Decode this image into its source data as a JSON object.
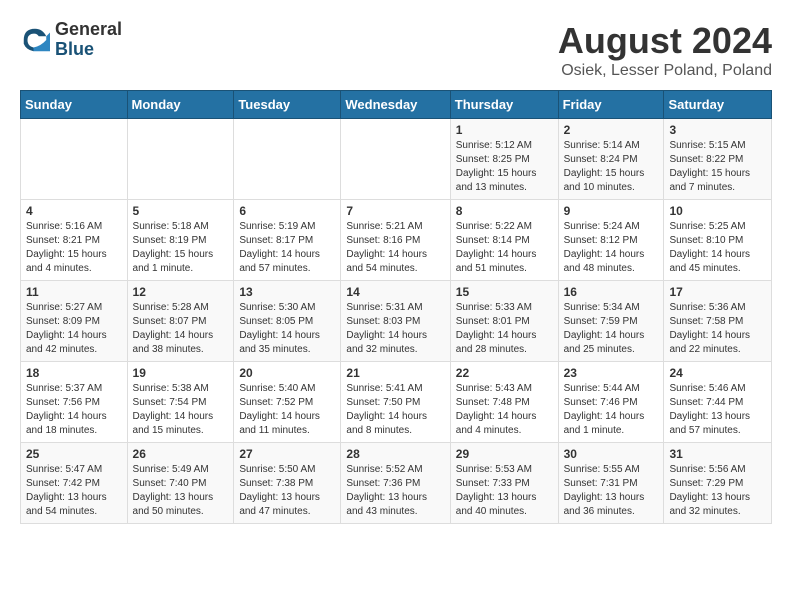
{
  "logo": {
    "general": "General",
    "blue": "Blue"
  },
  "header": {
    "month_year": "August 2024",
    "location": "Osiek, Lesser Poland, Poland"
  },
  "days_of_week": [
    "Sunday",
    "Monday",
    "Tuesday",
    "Wednesday",
    "Thursday",
    "Friday",
    "Saturday"
  ],
  "weeks": [
    [
      {
        "day": "",
        "info": ""
      },
      {
        "day": "",
        "info": ""
      },
      {
        "day": "",
        "info": ""
      },
      {
        "day": "",
        "info": ""
      },
      {
        "day": "1",
        "info": "Sunrise: 5:12 AM\nSunset: 8:25 PM\nDaylight: 15 hours\nand 13 minutes."
      },
      {
        "day": "2",
        "info": "Sunrise: 5:14 AM\nSunset: 8:24 PM\nDaylight: 15 hours\nand 10 minutes."
      },
      {
        "day": "3",
        "info": "Sunrise: 5:15 AM\nSunset: 8:22 PM\nDaylight: 15 hours\nand 7 minutes."
      }
    ],
    [
      {
        "day": "4",
        "info": "Sunrise: 5:16 AM\nSunset: 8:21 PM\nDaylight: 15 hours\nand 4 minutes."
      },
      {
        "day": "5",
        "info": "Sunrise: 5:18 AM\nSunset: 8:19 PM\nDaylight: 15 hours\nand 1 minute."
      },
      {
        "day": "6",
        "info": "Sunrise: 5:19 AM\nSunset: 8:17 PM\nDaylight: 14 hours\nand 57 minutes."
      },
      {
        "day": "7",
        "info": "Sunrise: 5:21 AM\nSunset: 8:16 PM\nDaylight: 14 hours\nand 54 minutes."
      },
      {
        "day": "8",
        "info": "Sunrise: 5:22 AM\nSunset: 8:14 PM\nDaylight: 14 hours\nand 51 minutes."
      },
      {
        "day": "9",
        "info": "Sunrise: 5:24 AM\nSunset: 8:12 PM\nDaylight: 14 hours\nand 48 minutes."
      },
      {
        "day": "10",
        "info": "Sunrise: 5:25 AM\nSunset: 8:10 PM\nDaylight: 14 hours\nand 45 minutes."
      }
    ],
    [
      {
        "day": "11",
        "info": "Sunrise: 5:27 AM\nSunset: 8:09 PM\nDaylight: 14 hours\nand 42 minutes."
      },
      {
        "day": "12",
        "info": "Sunrise: 5:28 AM\nSunset: 8:07 PM\nDaylight: 14 hours\nand 38 minutes."
      },
      {
        "day": "13",
        "info": "Sunrise: 5:30 AM\nSunset: 8:05 PM\nDaylight: 14 hours\nand 35 minutes."
      },
      {
        "day": "14",
        "info": "Sunrise: 5:31 AM\nSunset: 8:03 PM\nDaylight: 14 hours\nand 32 minutes."
      },
      {
        "day": "15",
        "info": "Sunrise: 5:33 AM\nSunset: 8:01 PM\nDaylight: 14 hours\nand 28 minutes."
      },
      {
        "day": "16",
        "info": "Sunrise: 5:34 AM\nSunset: 7:59 PM\nDaylight: 14 hours\nand 25 minutes."
      },
      {
        "day": "17",
        "info": "Sunrise: 5:36 AM\nSunset: 7:58 PM\nDaylight: 14 hours\nand 22 minutes."
      }
    ],
    [
      {
        "day": "18",
        "info": "Sunrise: 5:37 AM\nSunset: 7:56 PM\nDaylight: 14 hours\nand 18 minutes."
      },
      {
        "day": "19",
        "info": "Sunrise: 5:38 AM\nSunset: 7:54 PM\nDaylight: 14 hours\nand 15 minutes."
      },
      {
        "day": "20",
        "info": "Sunrise: 5:40 AM\nSunset: 7:52 PM\nDaylight: 14 hours\nand 11 minutes."
      },
      {
        "day": "21",
        "info": "Sunrise: 5:41 AM\nSunset: 7:50 PM\nDaylight: 14 hours\nand 8 minutes."
      },
      {
        "day": "22",
        "info": "Sunrise: 5:43 AM\nSunset: 7:48 PM\nDaylight: 14 hours\nand 4 minutes."
      },
      {
        "day": "23",
        "info": "Sunrise: 5:44 AM\nSunset: 7:46 PM\nDaylight: 14 hours\nand 1 minute."
      },
      {
        "day": "24",
        "info": "Sunrise: 5:46 AM\nSunset: 7:44 PM\nDaylight: 13 hours\nand 57 minutes."
      }
    ],
    [
      {
        "day": "25",
        "info": "Sunrise: 5:47 AM\nSunset: 7:42 PM\nDaylight: 13 hours\nand 54 minutes."
      },
      {
        "day": "26",
        "info": "Sunrise: 5:49 AM\nSunset: 7:40 PM\nDaylight: 13 hours\nand 50 minutes."
      },
      {
        "day": "27",
        "info": "Sunrise: 5:50 AM\nSunset: 7:38 PM\nDaylight: 13 hours\nand 47 minutes."
      },
      {
        "day": "28",
        "info": "Sunrise: 5:52 AM\nSunset: 7:36 PM\nDaylight: 13 hours\nand 43 minutes."
      },
      {
        "day": "29",
        "info": "Sunrise: 5:53 AM\nSunset: 7:33 PM\nDaylight: 13 hours\nand 40 minutes."
      },
      {
        "day": "30",
        "info": "Sunrise: 5:55 AM\nSunset: 7:31 PM\nDaylight: 13 hours\nand 36 minutes."
      },
      {
        "day": "31",
        "info": "Sunrise: 5:56 AM\nSunset: 7:29 PM\nDaylight: 13 hours\nand 32 minutes."
      }
    ]
  ]
}
